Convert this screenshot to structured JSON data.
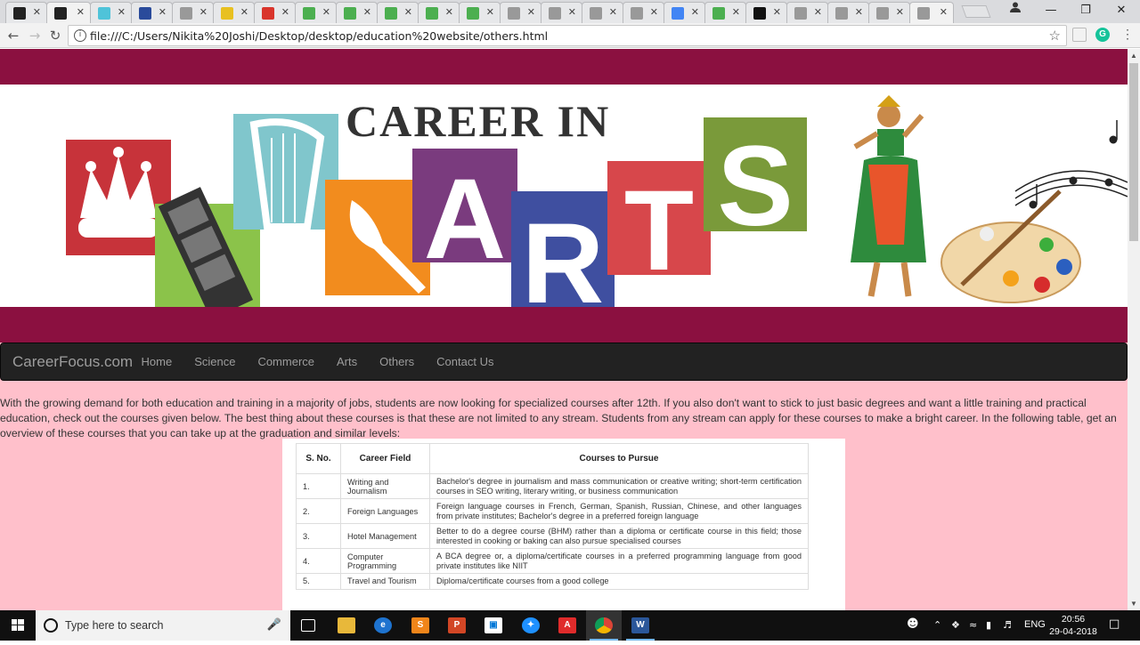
{
  "browser": {
    "tabs": [
      {
        "icon": "mortarboard-favicon-icon",
        "color": "#222"
      },
      {
        "icon": "mortarboard-favicon-icon",
        "color": "#222",
        "active": true
      },
      {
        "icon": "circle-favicon-icon",
        "color": "#4fc3d9"
      },
      {
        "icon": "app-favicon-icon",
        "color": "#2a4b9b"
      },
      {
        "icon": "page-favicon-icon",
        "color": "#999"
      },
      {
        "icon": "yellow-favicon-icon",
        "color": "#e8c020"
      },
      {
        "icon": "opera-favicon-icon",
        "color": "#d9352c"
      },
      {
        "icon": "w3schools-favicon-icon",
        "color": "#4caf50"
      },
      {
        "icon": "w3schools-favicon-icon",
        "color": "#4caf50"
      },
      {
        "icon": "w3schools-favicon-icon",
        "color": "#4caf50"
      },
      {
        "icon": "w3schools-favicon-icon",
        "color": "#4caf50"
      },
      {
        "icon": "w3schools-favicon-icon",
        "color": "#4caf50"
      },
      {
        "icon": "page-favicon-icon",
        "color": "#999"
      },
      {
        "icon": "page-favicon-icon",
        "color": "#999"
      },
      {
        "icon": "page-favicon-icon",
        "color": "#999"
      },
      {
        "icon": "page-favicon-icon",
        "color": "#999"
      },
      {
        "icon": "google-favicon-icon",
        "color": "#4285f4"
      },
      {
        "icon": "w3schools-favicon-icon",
        "color": "#4caf50"
      },
      {
        "icon": "github-favicon-icon",
        "color": "#111"
      },
      {
        "icon": "page-favicon-icon",
        "color": "#999"
      },
      {
        "icon": "page-favicon-icon",
        "color": "#999"
      },
      {
        "icon": "page-favicon-icon",
        "color": "#999"
      },
      {
        "icon": "page-favicon-icon",
        "color": "#999",
        "active": true
      }
    ],
    "tab_close_glyph": "✕",
    "url": "file:///C:/Users/Nikita%20Joshi/Desktop/desktop/education%20website/others.html"
  },
  "page": {
    "banner": {
      "headline": "CAREER IN",
      "letters": [
        "A",
        "R",
        "T",
        "S"
      ],
      "band_color": "#8b1040"
    },
    "navbar": {
      "brand": "CareerFocus.com",
      "links": [
        "Home",
        "Science",
        "Commerce",
        "Arts",
        "Others",
        "Contact Us"
      ]
    },
    "intro": "With the growing demand for both education and training in a majority of jobs, students are now looking for specialized courses after 12th. If you also don't want to stick to just basic degrees and want a little training and practical education, check out the courses given below. The best thing about these courses is that these are not limited to any stream. Students from any stream can apply for these courses to make a bright career. In the following table, get an overview of these courses that you can take up at the graduation and similar levels:",
    "table": {
      "headers": [
        "S. No.",
        "Career Field",
        "Courses to Pursue"
      ],
      "rows": [
        [
          "1.",
          "Writing and Journalism",
          "Bachelor's degree in journalism and mass communication or creative writing; short-term certification courses in SEO writing, literary writing, or business communication"
        ],
        [
          "2.",
          "Foreign Languages",
          "Foreign language courses in French, German, Spanish, Russian, Chinese, and other languages from private institutes; Bachelor's degree in a preferred foreign language"
        ],
        [
          "3.",
          "Hotel Management",
          "Better to do a degree course (BHM) rather than a diploma or certificate course in this field; those interested in cooking or baking can also pursue specialised courses"
        ],
        [
          "4.",
          "Computer Programming",
          "A BCA degree or, a diploma/certificate courses in a preferred programming language from good private institutes like NIIT"
        ],
        [
          "5.",
          "Travel and Tourism",
          "Diploma/certificate courses from a good college"
        ]
      ]
    }
  },
  "taskbar": {
    "search_placeholder": "Type here to search",
    "language": "ENG",
    "time": "20:56",
    "date": "29-04-2018"
  }
}
